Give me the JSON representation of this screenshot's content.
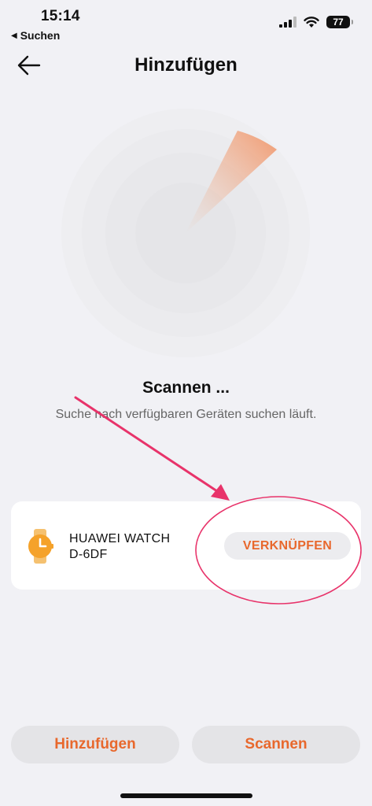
{
  "status_bar": {
    "time": "15:14",
    "back_app_label": "Suchen",
    "battery": "77",
    "icons": [
      "cellular-signal-icon",
      "wifi-icon",
      "battery-icon"
    ]
  },
  "nav": {
    "title": "Hinzufügen",
    "back_icon": "arrow-left-icon"
  },
  "scan": {
    "title": "Scannen ...",
    "subtitle": "Suche nach verfügbaren Geräten suchen läuft."
  },
  "device": {
    "icon": "watch-icon",
    "name_line1": "HUAWEI WATCH",
    "name_line2": "D-6DF",
    "link_label": "VERKNÜPFEN"
  },
  "actions": {
    "add_label": "Hinzufügen",
    "scan_label": "Scannen"
  },
  "colors": {
    "accent": "#e8682d",
    "annotation": "#e8336a",
    "background": "#f1f1f5"
  }
}
